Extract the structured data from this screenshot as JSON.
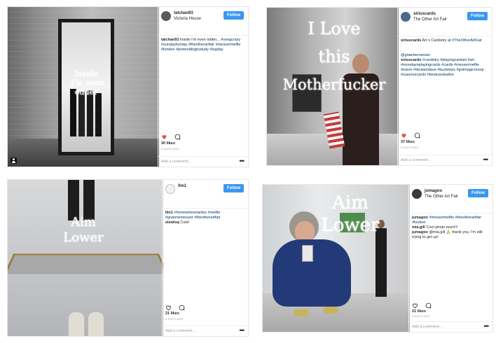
{
  "posts": [
    {
      "username": "talchan93",
      "location": "Victoria House",
      "follow_label": "Follow",
      "caption_user": "talchan93",
      "caption_text": "Inside I'm even odder...",
      "caption_tags": "#songcrazy #sundayfunday #theotherartfair #messermelfie #london #pretendingtostudy #legday",
      "likes": "30 likes",
      "time_ago": "3 days ago",
      "comment_placeholder": "Add a comment...",
      "more_label": "•••",
      "overlay_lines": [
        "Inside",
        "I'm even",
        "odder"
      ]
    },
    {
      "username": "siriuscards",
      "location": "The Other Art Fair",
      "follow_label": "Follow",
      "caption_user": "siriuscards",
      "caption_text": "Art x Cardistry at",
      "caption_tags": "#TheOtherArtFair",
      "caption_dots": ".\n.",
      "caption_mention": "@graememesser",
      "caption2_user": "siriuscards",
      "caption2_tags": "#cardistry #playingcardart #art #mondaynplayingcards #cards #messermelfie #eavm #deviantdave #bucklows #gotmagicmoop #useyourcards #bestcardsalive",
      "likes": "37 likes",
      "time_ago": "4 days ago",
      "comment_placeholder": "Add a comment...",
      "more_label": "•••",
      "overlay_lines": [
        "I Love",
        "this",
        "Motherfucker"
      ]
    },
    {
      "username": "llm1",
      "location": "",
      "follow_label": "Follow",
      "caption_user": "llm1",
      "caption_text": "",
      "caption_tags": "#homewheretartsis #melfie #graememesser #theotherartfair",
      "caption2_user": "elewisq",
      "caption2_text": "Cute!",
      "likes": "21 likes",
      "time_ago": "4 days ago",
      "comment_placeholder": "Add a comment...",
      "more_label": "•••",
      "overlay_lines": [
        "Aim",
        "Lower"
      ]
    },
    {
      "username": "jumagoo",
      "location": "The Other Art Fair",
      "follow_label": "Follow",
      "caption_user": "jumagoo",
      "caption_text": "",
      "caption_tags": "#messermelfie #theotherartfair #london",
      "caption2_user": "mia.gill",
      "caption2_text": "Cool photo mum!!!",
      "caption3_user": "jumagoo",
      "caption3_text": "@mia.gill 🙏 thank you, I'm still trying to get up!",
      "likes": "21 likes",
      "time_ago": "3 days ago",
      "comment_placeholder": "Add a comment...",
      "more_label": "•••",
      "overlay_lines": [
        "Aim",
        "Lower"
      ]
    }
  ],
  "colors": {
    "follow_bg": "#3897f0",
    "heart_red": "#ed4956",
    "tag_blue": "#003569"
  },
  "icons": [
    "heart-icon",
    "comment-icon",
    "more-icon",
    "user-tag-icon"
  ]
}
